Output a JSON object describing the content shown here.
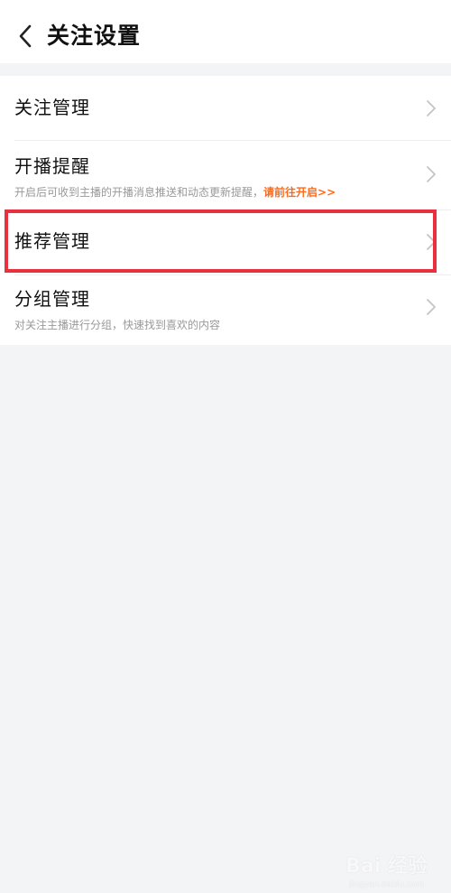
{
  "header": {
    "title": "关注设置",
    "back_icon": "chevron-left-icon"
  },
  "list": {
    "items": [
      {
        "title": "关注管理",
        "chevron_icon": "chevron-right-icon"
      },
      {
        "title": "开播提醒",
        "subtitle": "开启后可收到主播的开播消息推送和动态更新提醒，",
        "link": "请前往开启>>",
        "chevron_icon": "chevron-right-icon"
      },
      {
        "title": "推荐管理",
        "chevron_icon": "chevron-right-icon"
      },
      {
        "title": "分组管理",
        "subtitle": "对关注主播进行分组，快速找到喜欢的内容",
        "chevron_icon": "chevron-right-icon"
      }
    ]
  },
  "watermark": {
    "text": "Bai 经验",
    "subtext": "jingyan.baidu.com"
  },
  "colors": {
    "background": "#f3f4f6",
    "surface": "#ffffff",
    "link_orange": "#ff6a1a",
    "highlight_red": "#e8303f",
    "subtext_gray": "#999999"
  }
}
